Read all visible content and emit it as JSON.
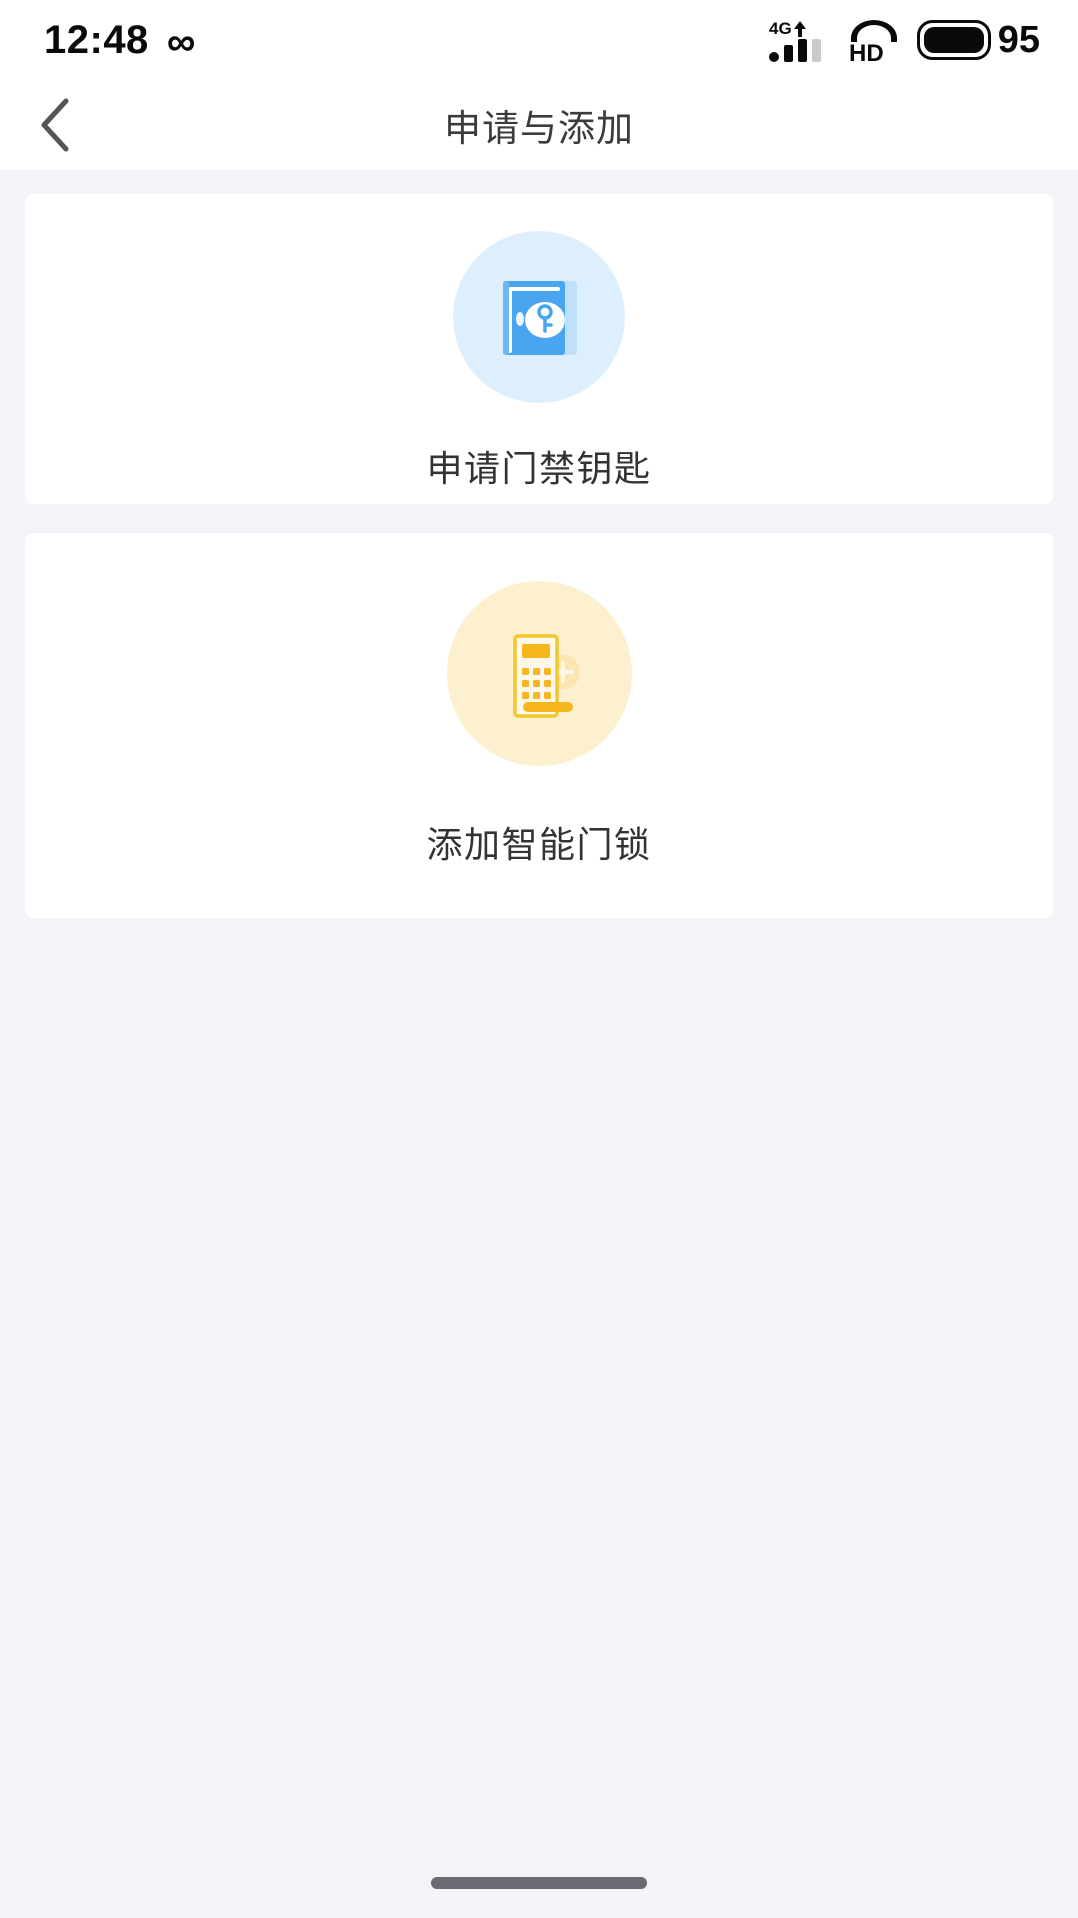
{
  "status_bar": {
    "time": "12:48",
    "infinity_symbol": "∞",
    "network_label": "4G",
    "hd_label": "HD",
    "battery_percent": "95"
  },
  "nav": {
    "title": "申请与添加",
    "back_label": "‹"
  },
  "cards": [
    {
      "label": "申请门禁钥匙",
      "icon": "door-key-icon",
      "circle_color": "#ddeffd",
      "icon_color": "#4aa5f0"
    },
    {
      "label": "添加智能门锁",
      "icon": "smart-lock-add-icon",
      "circle_color": "#fdf0cf",
      "icon_color": "#f5bb1d"
    }
  ],
  "theme": {
    "page_background": "#f4f4f8",
    "card_background": "#ffffff",
    "title_color": "#3b3b3b",
    "label_color": "#333333",
    "home_indicator_color": "#6b6b73"
  }
}
